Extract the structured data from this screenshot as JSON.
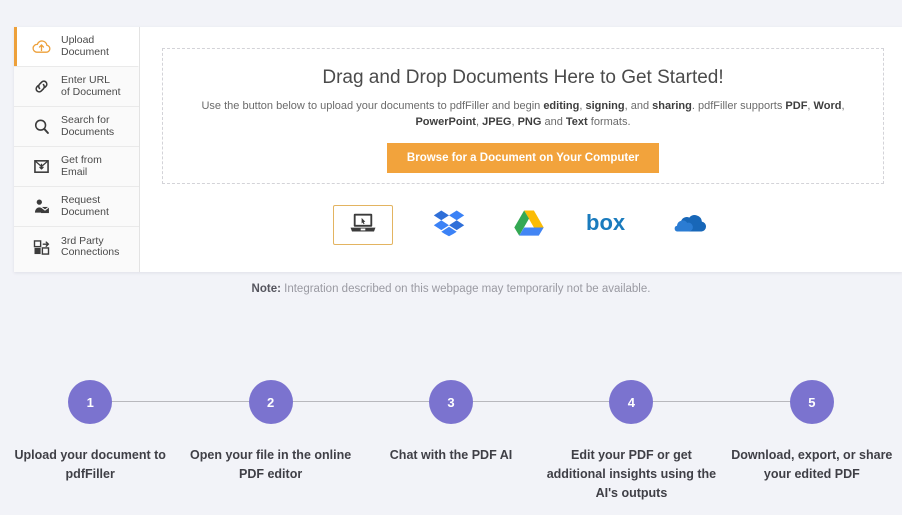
{
  "colors": {
    "accent_orange": "#f2a33c",
    "active_bar": "#eda03a",
    "step_purple": "#7b73cf",
    "page_background": "#f2f3f8",
    "panel_background": "#ffffff"
  },
  "sidebar": {
    "items": [
      {
        "label_line1": "Upload",
        "label_line2": "Document",
        "icon": "upload-cloud-icon",
        "active": true
      },
      {
        "label_line1": "Enter URL",
        "label_line2": "of Document",
        "icon": "link-icon",
        "active": false
      },
      {
        "label_line1": "Search for",
        "label_line2": "Documents",
        "icon": "search-icon",
        "active": false
      },
      {
        "label_line1": "Get from",
        "label_line2": "Email",
        "icon": "email-download-icon",
        "active": false
      },
      {
        "label_line1": "Request",
        "label_line2": "Document",
        "icon": "request-document-icon",
        "active": false
      },
      {
        "label_line1": "3rd Party",
        "label_line2": "Connections",
        "icon": "third-party-connections-icon",
        "active": false
      }
    ]
  },
  "dropzone": {
    "title": "Drag and Drop Documents Here to Get Started!",
    "subtitle_parts": [
      {
        "text": "Use the button below to upload your documents to pdfFiller and begin ",
        "bold": false
      },
      {
        "text": "editing",
        "bold": true
      },
      {
        "text": ", ",
        "bold": false
      },
      {
        "text": "signing",
        "bold": true
      },
      {
        "text": ", and ",
        "bold": false
      },
      {
        "text": "sharing",
        "bold": true
      },
      {
        "text": ". pdfFiller supports ",
        "bold": false
      },
      {
        "text": "PDF",
        "bold": true
      },
      {
        "text": ", ",
        "bold": false
      },
      {
        "text": "Word",
        "bold": true
      },
      {
        "text": ", ",
        "bold": false
      },
      {
        "text": "PowerPoint",
        "bold": true
      },
      {
        "text": ", ",
        "bold": false
      },
      {
        "text": "JPEG",
        "bold": true
      },
      {
        "text": ", ",
        "bold": false
      },
      {
        "text": "PNG",
        "bold": true
      },
      {
        "text": " and ",
        "bold": false
      },
      {
        "text": "Text",
        "bold": true
      },
      {
        "text": " formats.",
        "bold": false
      }
    ],
    "browse_button_label": "Browse for a Document on Your Computer"
  },
  "sources": [
    {
      "name": "my-computer",
      "icon": "laptop-icon",
      "selected": true
    },
    {
      "name": "dropbox",
      "icon": "dropbox-icon",
      "selected": false
    },
    {
      "name": "google-drive",
      "icon": "google-drive-icon",
      "selected": false
    },
    {
      "name": "box",
      "icon": "box-icon",
      "selected": false
    },
    {
      "name": "onedrive",
      "icon": "onedrive-icon",
      "selected": false
    }
  ],
  "note": {
    "label": "Note:",
    "text": " Integration described on this webpage may temporarily not be available."
  },
  "steps": [
    {
      "number": "1",
      "label": "Upload your document to pdfFiller"
    },
    {
      "number": "2",
      "label": "Open your file in the online PDF editor"
    },
    {
      "number": "3",
      "label": "Chat with the PDF AI"
    },
    {
      "number": "4",
      "label": "Edit your PDF or get additional insights using the AI's outputs"
    },
    {
      "number": "5",
      "label": "Download, export, or share your edited PDF"
    }
  ]
}
